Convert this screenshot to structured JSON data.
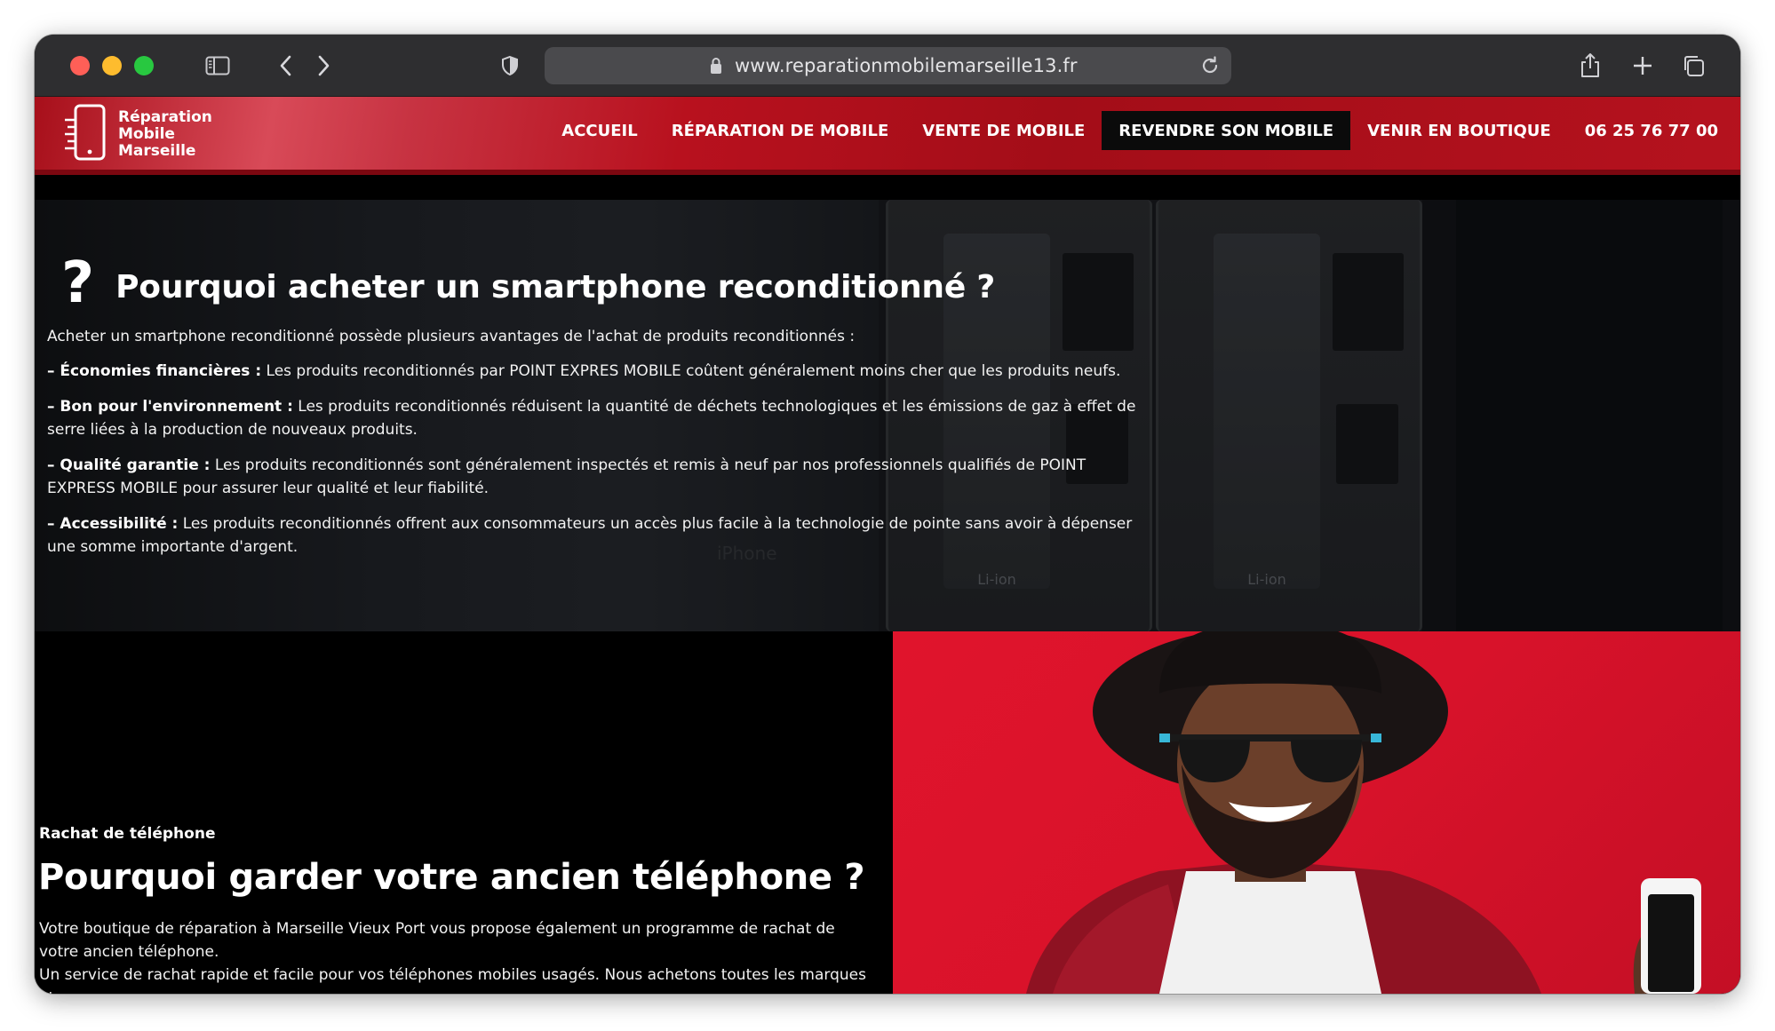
{
  "browser": {
    "url": "www.reparationmobilemarseille13.fr"
  },
  "site": {
    "logo_lines": [
      "Réparation",
      "Mobile",
      "Marseille"
    ],
    "nav": [
      {
        "label": "ACCUEIL"
      },
      {
        "label": "RÉPARATION DE MOBILE"
      },
      {
        "label": "VENTE DE MOBILE"
      },
      {
        "label": "REVENDRE SON MOBILE",
        "active": true
      },
      {
        "label": "VENIR EN BOUTIQUE"
      },
      {
        "label": "06 25 76 77 00"
      }
    ],
    "colors": {
      "brand_red": "#b8111e",
      "active_bg": "#0b0b0b"
    }
  },
  "section1": {
    "title": "Pourquoi acheter un smartphone reconditionné ?",
    "intro": "Acheter un smartphone reconditionné possède plusieurs avantages de l'achat de produits reconditionnés :",
    "items": [
      {
        "lead": "– Économies financières :",
        "text": " Les produits reconditionnés par POINT EXPRES MOBILE coûtent généralement moins cher que les produits neufs."
      },
      {
        "lead": "– Bon pour l'environnement :",
        "text": " Les produits reconditionnés réduisent la quantité de déchets technologiques et les émissions de gaz à effet de serre liées à la production de nouveaux produits."
      },
      {
        "lead": "– Qualité garantie :",
        "text": " Les produits reconditionnés sont généralement inspectés et remis à neuf par nos professionnels qualifiés de POINT EXPRESS MOBILE  pour assurer leur qualité et leur fiabilité."
      },
      {
        "lead": "– Accessibilité :",
        "text": " Les produits reconditionnés offrent aux consommateurs un accès plus facile à la technologie de pointe sans avoir à dépenser une somme importante d'argent."
      }
    ],
    "background_texts": {
      "battery": "Li-ion",
      "ghost": "iPhone"
    }
  },
  "section2": {
    "kicker": "Rachat de téléphone",
    "title": "Pourquoi garder votre ancien téléphone ?",
    "body_1": "Votre boutique de réparation à Marseille Vieux Port vous propose également un programme de rachat de votre ancien téléphone.",
    "body_2": "Un service de rachat rapide et facile pour vos téléphones mobiles usagés. Nous achetons toutes les marques et"
  }
}
